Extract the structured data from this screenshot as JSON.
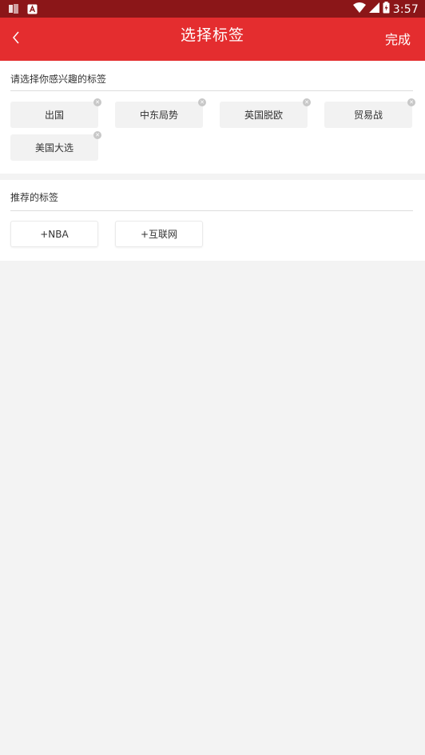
{
  "status_bar": {
    "time": "3:57",
    "icons": [
      "notification-icon",
      "app-icon",
      "wifi-icon",
      "cell-signal-icon",
      "battery-icon"
    ]
  },
  "header": {
    "title": "选择标签",
    "done_label": "完成",
    "back_icon": "chevron-left-icon",
    "background_color": "#e42d2f"
  },
  "selected_section": {
    "title": "请选择你感兴趣的标签",
    "tags": [
      {
        "label": "出国"
      },
      {
        "label": "中东局势"
      },
      {
        "label": "英国脱欧"
      },
      {
        "label": "贸易战"
      },
      {
        "label": "美国大选"
      }
    ],
    "remove_icon": "remove-icon"
  },
  "recommend_section": {
    "title": "推荐的标签",
    "tags": [
      {
        "label": "+NBA"
      },
      {
        "label": "+互联网"
      }
    ]
  }
}
